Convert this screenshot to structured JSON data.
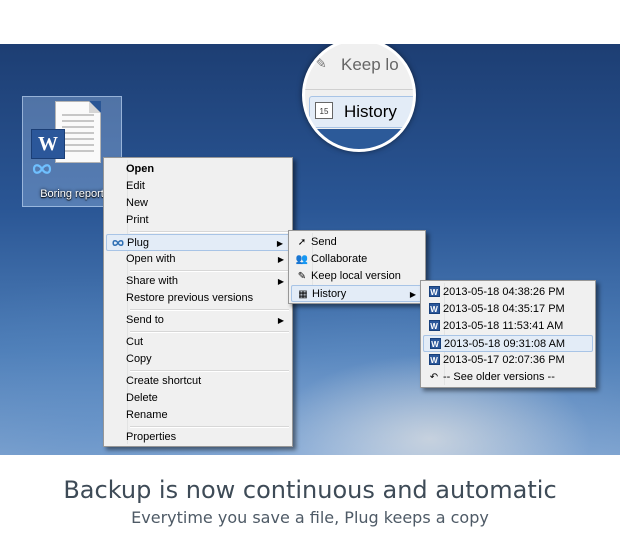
{
  "desktop": {
    "file": {
      "name": "Boring report",
      "app_badge": "W"
    }
  },
  "context_menu": {
    "items": [
      "Open",
      "Edit",
      "New",
      "Print",
      "Plug",
      "Open with",
      "Share with",
      "Restore previous versions",
      "Send to",
      "Cut",
      "Copy",
      "Create shortcut",
      "Delete",
      "Rename",
      "Properties"
    ]
  },
  "plug_submenu": {
    "items": [
      "Send",
      "Collaborate",
      "Keep local version",
      "History"
    ]
  },
  "history_submenu": {
    "versions": [
      "2013-05-18 04:38:26 PM",
      "2013-05-18 04:35:17 PM",
      "2013-05-18 11:53:41 AM",
      "2013-05-18 09:31:08 AM",
      "2013-05-17 02:07:36 PM"
    ],
    "older": "-- See older versions --",
    "selected_index": 3
  },
  "magnifier": {
    "keep_text": "Keep lo",
    "history_text": "History",
    "calendar_day": "15"
  },
  "caption": {
    "title": "Backup is now continuous and automatic",
    "subtitle": "Everytime you save a file, Plug keeps a copy"
  },
  "colors": {
    "menu_bg": "#f0f0f0",
    "highlight": "#e3ecf7",
    "word_blue": "#2b579a",
    "caption_text": "#3e4b57"
  }
}
